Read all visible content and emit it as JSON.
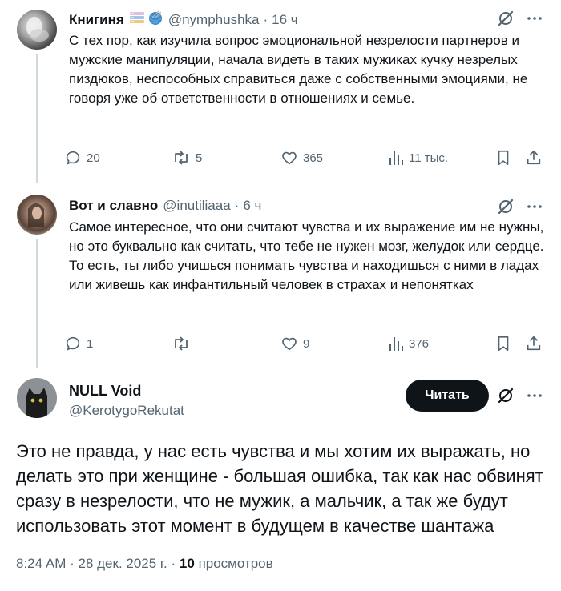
{
  "replies": [
    {
      "name": "Книгиня",
      "badges": [
        "books-emoji",
        "yarn-emoji"
      ],
      "handle": "@nymphushka",
      "time": "16 ч",
      "text": "С тех пор, как изучила вопрос эмоциональной незрелости партнеров и мужские манипуляции, начала видеть в таких мужиках кучку незрелых пиздюков, неспособных справиться даже с собственными эмоциями, не говоря уже об ответственности в отношениях и семье.",
      "replies": "20",
      "reposts": "5",
      "likes": "365",
      "views": "11 тыс."
    },
    {
      "name": "Вот и славно",
      "handle": "@inutiliaaa",
      "time": "6 ч",
      "text": "Самое интересное, что они считают чувства и их выражение им не нужны, но это буквально как считать, что тебе не нужен мозг, желудок или сердце. То есть, ты либо учишься понимать чувства и находишься с ними в ладах или живешь как инфантильный человек в страхах и непонятках",
      "replies": "1",
      "reposts": "",
      "likes": "9",
      "views": "376"
    }
  ],
  "main": {
    "name": "NULL Void",
    "handle": "@KerotygoRekutat",
    "follow_label": "Читать",
    "text": "Это не правда, у нас есть чувства и мы хотим их выражать, но делать это при женщине - большая ошибка, так как нас обвинят сразу в незрелости, что не мужик, а мальчик, а так же будут использовать этот момент в будущем в качестве шантажа",
    "time": "8:24 AM",
    "date": "28 дек. 2025 г.",
    "views_count": "10",
    "views_label": "просмотров"
  },
  "colors": {
    "text": "#0f1419",
    "secondary": "#536471",
    "thread_line": "#cfd9de",
    "button_bg": "#0f1419"
  }
}
